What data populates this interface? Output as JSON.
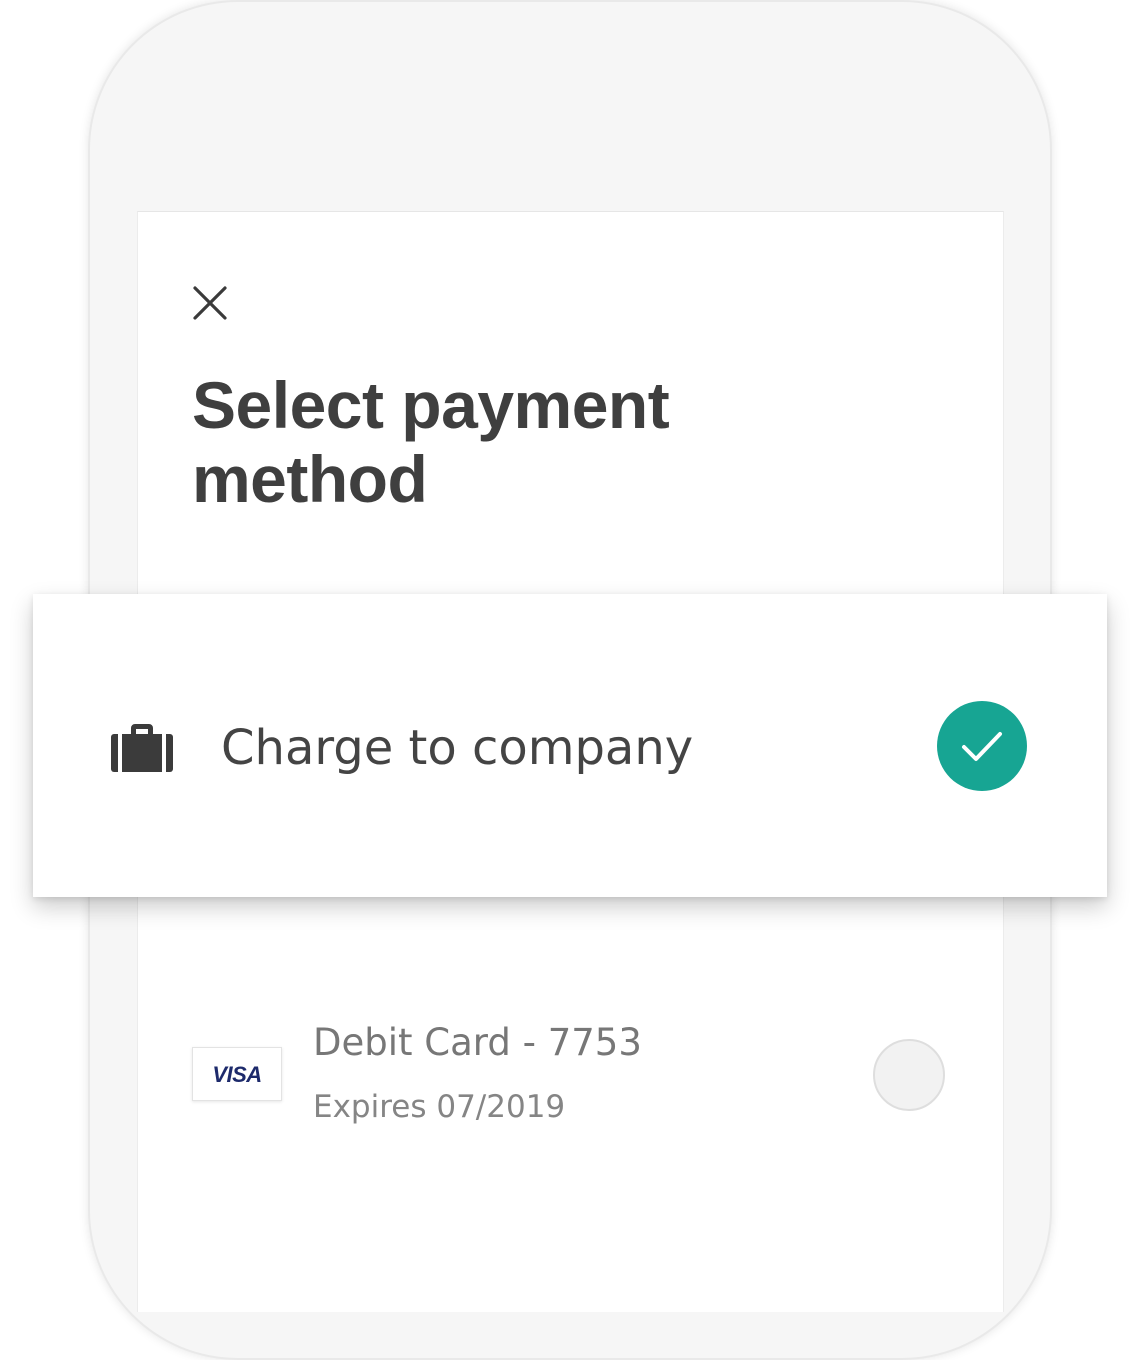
{
  "header": {
    "close_icon": "close-icon",
    "title": "Select payment method"
  },
  "payment_options": {
    "company": {
      "icon": "briefcase-icon",
      "label": "Charge to company",
      "selected": true,
      "accent_color": "#17a593"
    },
    "card": {
      "brand": "VISA",
      "name": "Debit Card - 7753",
      "expiry": "Expires 07/2019",
      "selected": false
    }
  },
  "colors": {
    "title": "#3f3f3f",
    "label": "#444444",
    "secondary_text": "#777777",
    "accent": "#17a593"
  }
}
